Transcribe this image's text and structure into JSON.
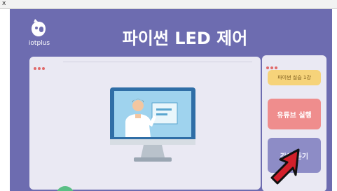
{
  "window": {
    "close_glyph": "x"
  },
  "header": {
    "logo_text": "iotplus",
    "title": "파이썬 LED 제어"
  },
  "side_buttons": [
    {
      "label": "파이썬 실습 1강"
    },
    {
      "label": "유튜브 실행"
    },
    {
      "label": "강의 듣기"
    }
  ],
  "icons": {
    "logo": "iotplus-logo-icon",
    "monitor": "monitor-teacher-icon",
    "cursor": "red-arrow-cursor-icon"
  },
  "colors": {
    "background": "#6d6cb0",
    "panel": "#eae9f3",
    "btn_yellow": "#f6d37a",
    "btn_red": "#ef8d8d",
    "btn_purple": "#8d8cc6",
    "dot": "#e06a6a"
  }
}
